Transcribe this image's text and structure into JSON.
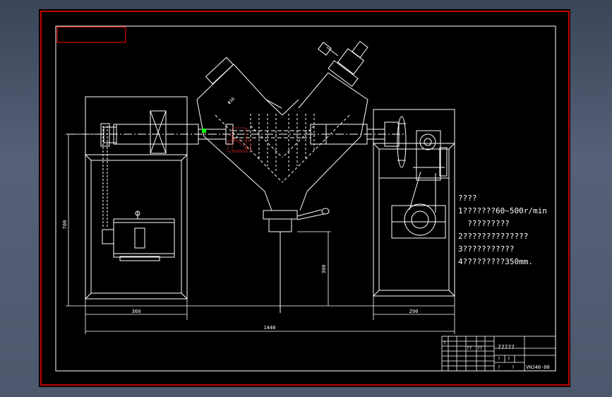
{
  "colors": {
    "background": "#000000",
    "line": "#ffffff",
    "frame": "#ff0000",
    "grip": "#00ff00",
    "selection": "#ff3030"
  },
  "dimensions": {
    "height_total": "700",
    "discharge_height": "300",
    "left_base_width": "360",
    "right_base_width": "290",
    "overall_length": "1440",
    "shaft_label": "Φ30"
  },
  "notes": {
    "title": "????",
    "lines": [
      "1???????60~500r/min",
      "  ?????????",
      "2??????????????",
      "3???????????",
      "4?????????350mm."
    ]
  },
  "title_block": {
    "name": "?????",
    "drawing_no": "VHJ40-00",
    "cell_labels": [
      "?",
      "??",
      "??",
      "?",
      "?",
      "?",
      "?"
    ]
  }
}
